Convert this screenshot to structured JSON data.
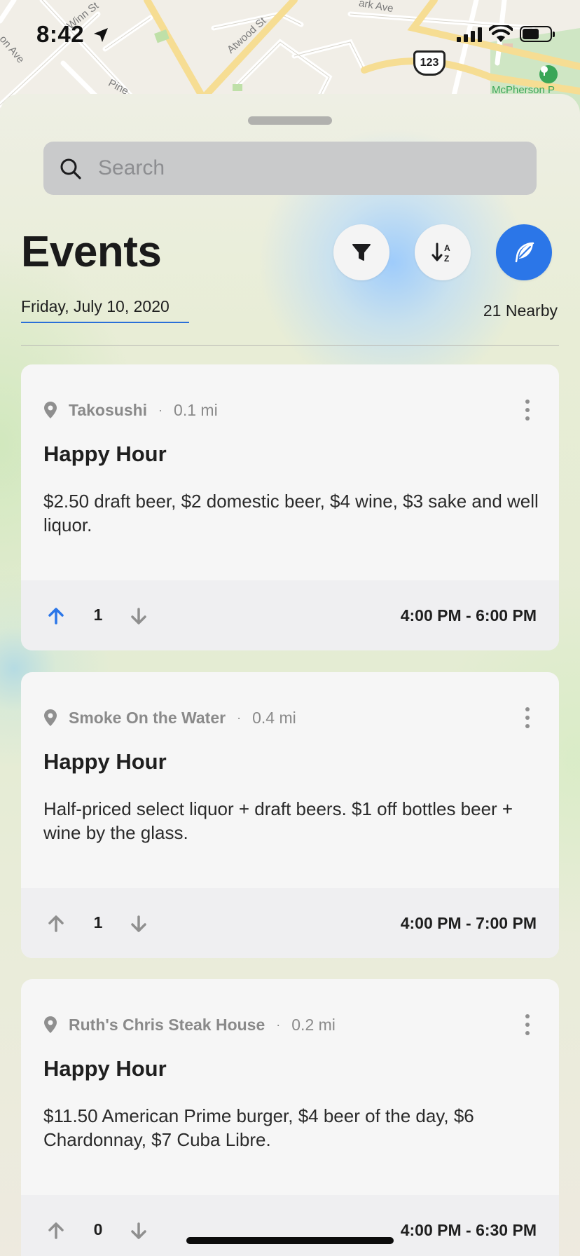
{
  "status_bar": {
    "time": "8:42"
  },
  "map": {
    "labels": {
      "winn": "Winn St",
      "atwood": "Atwood St",
      "park_ave": "ark Ave",
      "on_ave": "on Ave",
      "pine": "Pine",
      "route": "123",
      "mcpherson": "McPherson P"
    }
  },
  "search": {
    "placeholder": "Search"
  },
  "header": {
    "title": "Events",
    "date": "Friday, July 10, 2020",
    "nearby": "21 Nearby"
  },
  "colors": {
    "accent": "#2b76e8",
    "upvote_active": "#2b76e8",
    "vote_inactive": "#8f8f8f"
  },
  "events": [
    {
      "venue": "Takosushi",
      "separator": "·",
      "distance": "0.1 mi",
      "title": "Happy Hour",
      "description": "$2.50 draft beer, $2 domestic beer, $4 wine, $3 sake and well liquor.",
      "votes": "1",
      "upvoted": true,
      "time": "4:00 PM - 6:00 PM"
    },
    {
      "venue": "Smoke On the Water",
      "separator": "·",
      "distance": "0.4 mi",
      "title": "Happy Hour",
      "description": "Half-priced select liquor + draft beers. $1 off bottles beer + wine by the glass.",
      "votes": "1",
      "upvoted": false,
      "time": "4:00 PM - 7:00 PM"
    },
    {
      "venue": "Ruth's Chris Steak House",
      "separator": "·",
      "distance": "0.2 mi",
      "title": "Happy Hour",
      "description": "$11.50 American Prime burger, $4 beer of the day, $6 Chardonnay, $7 Cuba Libre.",
      "votes": "0",
      "upvoted": false,
      "time": "4:00 PM - 6:30 PM"
    }
  ]
}
